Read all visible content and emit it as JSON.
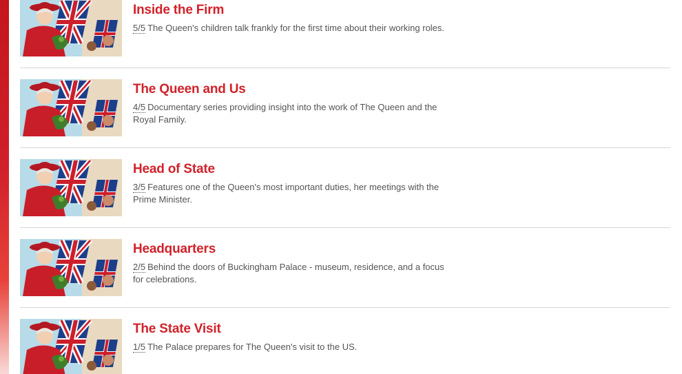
{
  "episodes": [
    {
      "title": "Inside the Firm",
      "episode": "5/5",
      "description": "The Queen's children talk frankly for the first time about their working roles.",
      "thumbnail": "queen-union-flags"
    },
    {
      "title": "The Queen and Us",
      "episode": "4/5",
      "description": "Documentary series providing insight into the work of The Queen and the Royal Family.",
      "thumbnail": "queen-union-flags"
    },
    {
      "title": "Head of State",
      "episode": "3/5",
      "description": "Features one of the Queen's most important duties, her meetings with the Prime Minister.",
      "thumbnail": "queen-union-flags"
    },
    {
      "title": "Headquarters",
      "episode": "2/5",
      "description": "Behind the doors of Buckingham Palace - museum, residence, and a focus for celebrations.",
      "thumbnail": "queen-union-flags"
    },
    {
      "title": "The State Visit",
      "episode": "1/5",
      "description": "The Palace prepares for The Queen's visit to the US.",
      "thumbnail": "queen-union-flags"
    }
  ],
  "colors": {
    "accent": "#d1222a",
    "text": "#545454",
    "divider": "#d6d6d6"
  }
}
